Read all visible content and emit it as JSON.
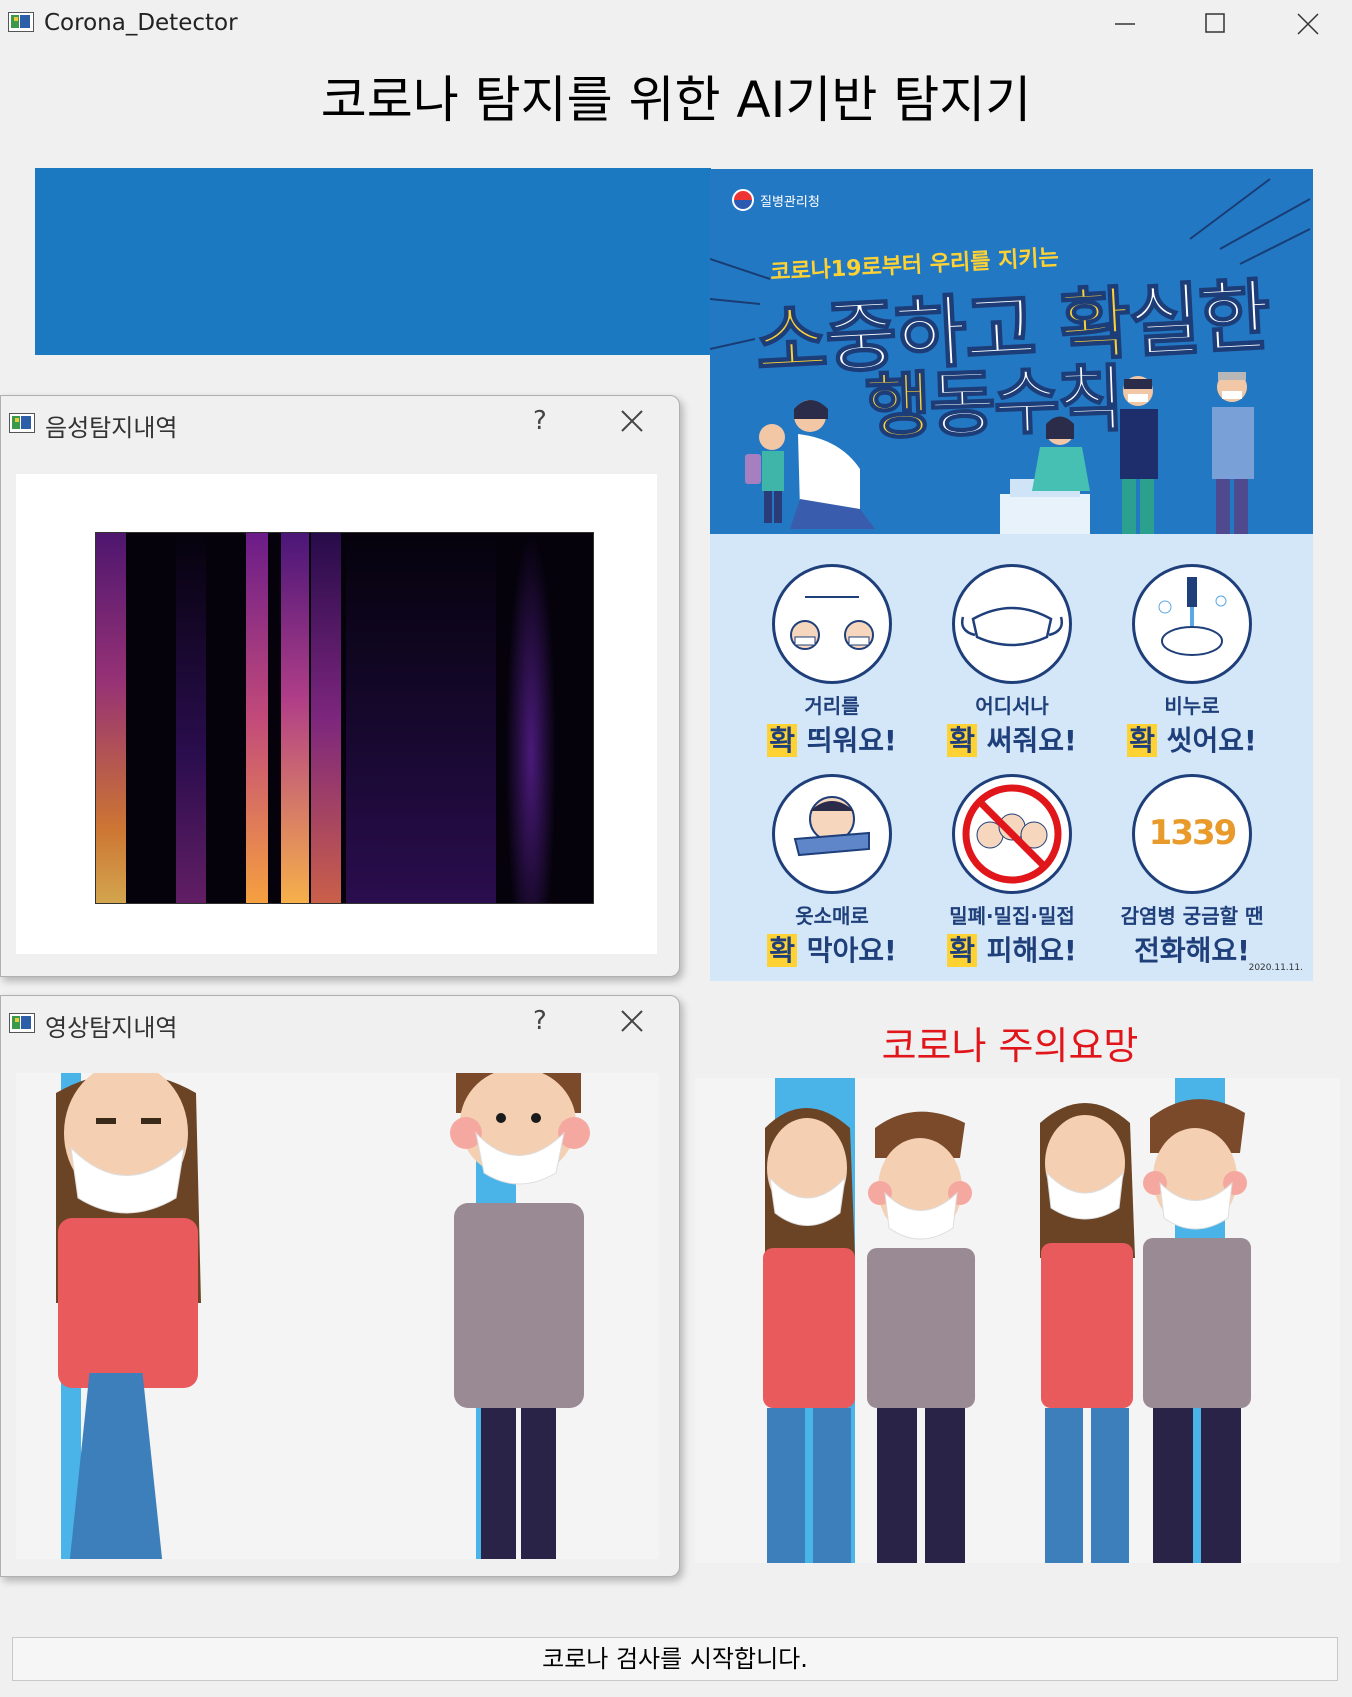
{
  "window": {
    "title": "Corona_Detector",
    "icon": "app-window-icon",
    "controls": [
      "minimize-icon",
      "maximize-icon",
      "close-icon"
    ]
  },
  "heading": "코로나 탐지를 위한 AI기반 탐지기",
  "poster": {
    "agency": "질병관리청",
    "subheadline": "코로나19로부터 우리를 지키는",
    "headline_a_hl": "소",
    "headline_a": "중하고 ",
    "headline_b_hl": "확",
    "headline_b": "실한",
    "headline_c_hl": "행",
    "headline_c": "동수칙",
    "rules": [
      {
        "line1": "거리를",
        "key": "확",
        "line2": " 띄워요!"
      },
      {
        "line1": "어디서나",
        "key": "확",
        "line2": " 써줘요!"
      },
      {
        "line1": "비누로",
        "key": "확",
        "line2": " 씻어요!"
      },
      {
        "line1": "옷소매로",
        "key": "확",
        "line2": " 막아요!"
      },
      {
        "line1": "밀폐·밀집·밀접",
        "key": "확",
        "line2": " 피해요!"
      },
      {
        "line1": "감염병 궁금할 땐",
        "key": "",
        "line2": "전화해요!"
      }
    ],
    "hotline": "1339",
    "date": "2020.11.11."
  },
  "warning": "코로나 주의요망",
  "dialogs": {
    "audio": {
      "title": "음성탐지내역",
      "help": "?"
    },
    "video": {
      "title": "영상탐지내역",
      "help": "?"
    }
  },
  "status": "코로나 검사를 시작합니다.",
  "colors": {
    "accent_blue": "#1b79c2",
    "warning_red": "#e0161b",
    "poster_yellow": "#ffd233"
  }
}
